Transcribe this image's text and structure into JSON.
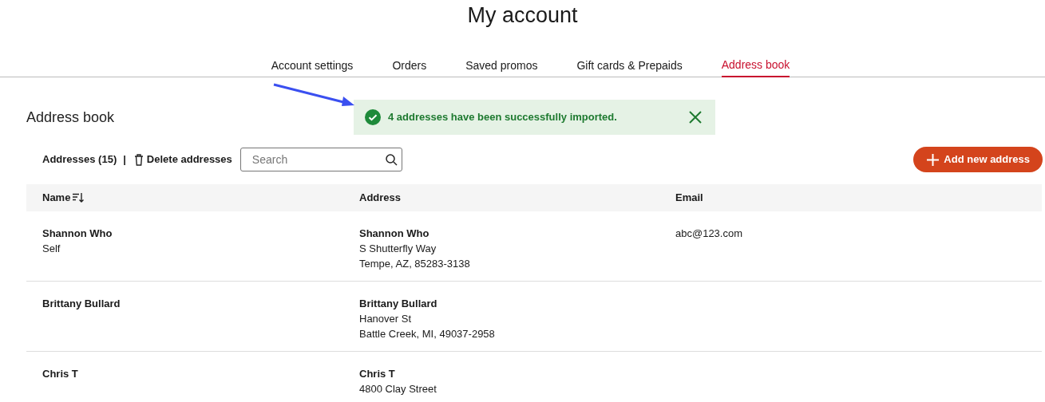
{
  "page_title": "My account",
  "tabs": [
    {
      "label": "Account settings",
      "selected": false
    },
    {
      "label": "Orders",
      "selected": false
    },
    {
      "label": "Saved promos",
      "selected": false
    },
    {
      "label": "Gift cards & Prepaids",
      "selected": false
    },
    {
      "label": "Address book",
      "selected": true
    }
  ],
  "section_title": "Address book",
  "toast": {
    "message": "4 addresses have been successfully imported."
  },
  "toolbar": {
    "count": "Addresses (15)",
    "separator": "|",
    "delete_label": "Delete addresses",
    "search": {
      "placeholder": "Search"
    },
    "add_button": "Add new address"
  },
  "table": {
    "columns": [
      "Name",
      "Address",
      "Email"
    ],
    "rows": [
      {
        "name": "Shannon Who",
        "relation": "Self",
        "address_name": "Shannon Who",
        "address_lines": [
          "S Shutterfly Way",
          "Tempe, AZ, 85283-3138"
        ],
        "email": "abc@123.com"
      },
      {
        "name": "Brittany Bullard",
        "address_name": "Brittany Bullard",
        "address_lines": [
          "Hanover St",
          "Battle Creek, MI, 49037-2958"
        ]
      },
      {
        "name": "Chris T",
        "address_name": "Chris T",
        "address_lines": [
          "4800 Clay Street"
        ]
      }
    ]
  }
}
